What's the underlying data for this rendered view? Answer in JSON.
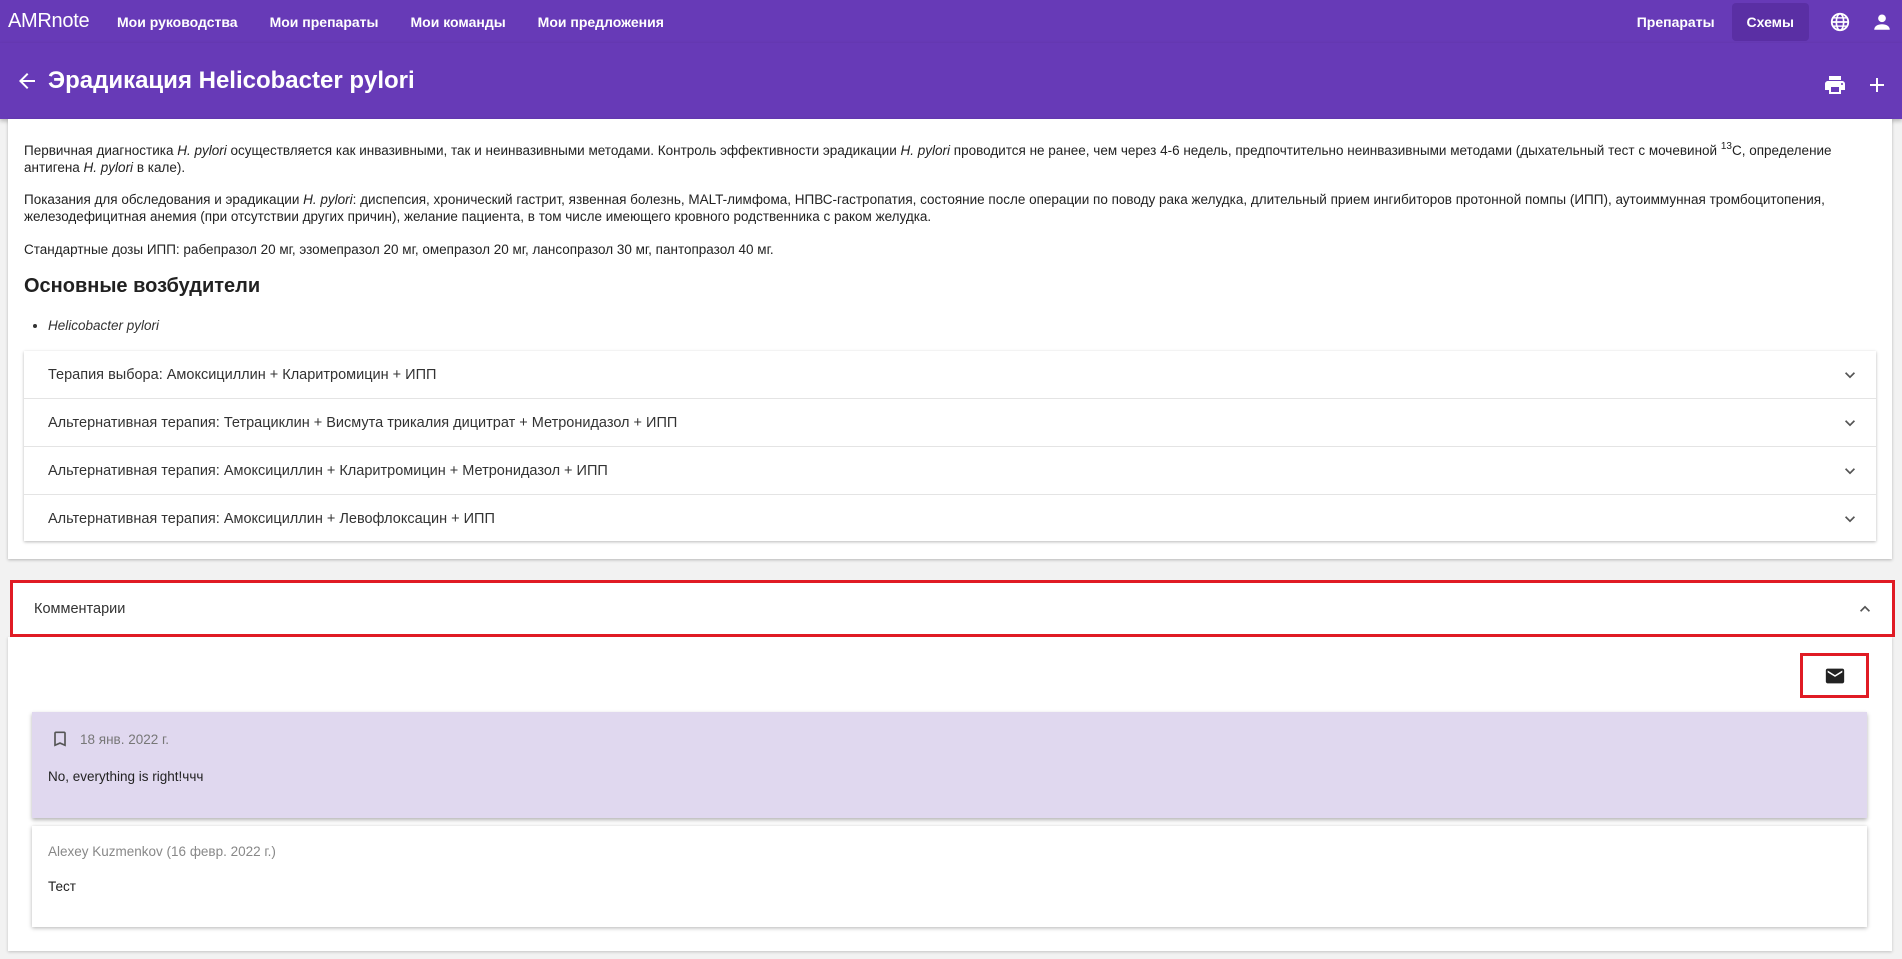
{
  "topbar": {
    "brand": "AMRnote",
    "nav": [
      "Мои руководства",
      "Мои препараты",
      "Мои команды",
      "Мои предложения"
    ],
    "right_link": "Препараты",
    "active_link": "Схемы",
    "icons": [
      "globe-icon",
      "account-icon"
    ]
  },
  "header": {
    "title": "Эрадикация Helicobacter pylori",
    "icons": [
      "back-arrow-icon",
      "print-icon",
      "add-icon"
    ]
  },
  "content": {
    "para1_a": "Первичная диагностика ",
    "para1_b": "H. pylori",
    "para1_c": " осуществляется как инвазивными, так и неинвазивными методами. Контроль эффективности эрадикации ",
    "para1_d": "H. pylori",
    "para1_e": " проводится не ранее, чем через 4-6 недель, предпочтительно неинвазивными методами (дыхательный тест с мочевиной ",
    "para1_sup": "13",
    "para1_f": "C, определение антигена ",
    "para1_g": "H. pylori",
    "para1_h": " в кале).",
    "para2_a": "Показания для обследования и эрадикации ",
    "para2_b": "H. pylori",
    "para2_c": ": диспепсия, хронический гастрит, язвенная болезнь, MALT-лимфома, НПВС-гастропатия, состояние после операции по поводу рака желудка, длительный прием ингибиторов протонной помпы (ИПП), аутоиммунная тромбоцитопения, железодефицитная анемия (при отсутствии других причин), желание пациента, в том числе имеющего кровного родственника с раком желудка.",
    "para3": "Стандартные дозы ИПП: рабепразол 20 мг, эзомепразол 20 мг, омепразол 20 мг, лансопразол 30 мг, пантопразол 40 мг.",
    "section_title": "Основные возбудители",
    "pathogens": [
      "Helicobacter pylori"
    ],
    "therapies": [
      "Терапия выбора: Амоксициллин + Кларитромицин + ИПП",
      "Альтернативная терапия: Тетрациклин + Висмута трикалия дицитрат + Метронидазол + ИПП",
      "Альтернативная терапия: Амоксициллин + Кларитромицин + Метронидазол + ИПП",
      "Альтернативная терапия: Амоксициллин + Левофлоксацин + ИПП"
    ]
  },
  "comments": {
    "title": "Комментарии",
    "send_icon": "mail-icon",
    "items": [
      {
        "date": "18 янв. 2022 г.",
        "text": "No, everything is right!ччч",
        "icon": "bookmark-icon"
      },
      {
        "author": "Alexey Kuzmenkov (16 февр. 2022 г.)",
        "text": "Тест"
      }
    ]
  },
  "colors": {
    "primary": "#673ab7",
    "primary_dark": "#5a2fa4",
    "highlight": "#e01b24",
    "comment_bg": "#e0d8ef"
  }
}
